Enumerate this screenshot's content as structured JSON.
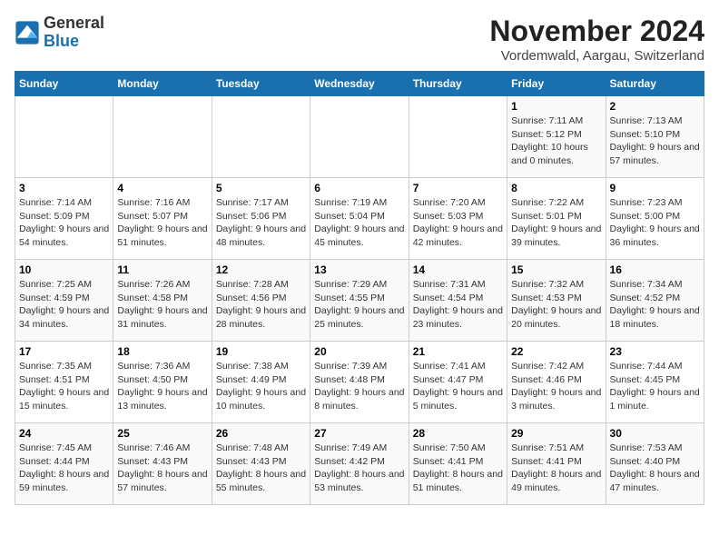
{
  "logo": {
    "general": "General",
    "blue": "Blue"
  },
  "header": {
    "title": "November 2024",
    "subtitle": "Vordemwald, Aargau, Switzerland"
  },
  "weekdays": [
    "Sunday",
    "Monday",
    "Tuesday",
    "Wednesday",
    "Thursday",
    "Friday",
    "Saturday"
  ],
  "weeks": [
    [
      {
        "day": "",
        "info": ""
      },
      {
        "day": "",
        "info": ""
      },
      {
        "day": "",
        "info": ""
      },
      {
        "day": "",
        "info": ""
      },
      {
        "day": "",
        "info": ""
      },
      {
        "day": "1",
        "info": "Sunrise: 7:11 AM\nSunset: 5:12 PM\nDaylight: 10 hours and 0 minutes."
      },
      {
        "day": "2",
        "info": "Sunrise: 7:13 AM\nSunset: 5:10 PM\nDaylight: 9 hours and 57 minutes."
      }
    ],
    [
      {
        "day": "3",
        "info": "Sunrise: 7:14 AM\nSunset: 5:09 PM\nDaylight: 9 hours and 54 minutes."
      },
      {
        "day": "4",
        "info": "Sunrise: 7:16 AM\nSunset: 5:07 PM\nDaylight: 9 hours and 51 minutes."
      },
      {
        "day": "5",
        "info": "Sunrise: 7:17 AM\nSunset: 5:06 PM\nDaylight: 9 hours and 48 minutes."
      },
      {
        "day": "6",
        "info": "Sunrise: 7:19 AM\nSunset: 5:04 PM\nDaylight: 9 hours and 45 minutes."
      },
      {
        "day": "7",
        "info": "Sunrise: 7:20 AM\nSunset: 5:03 PM\nDaylight: 9 hours and 42 minutes."
      },
      {
        "day": "8",
        "info": "Sunrise: 7:22 AM\nSunset: 5:01 PM\nDaylight: 9 hours and 39 minutes."
      },
      {
        "day": "9",
        "info": "Sunrise: 7:23 AM\nSunset: 5:00 PM\nDaylight: 9 hours and 36 minutes."
      }
    ],
    [
      {
        "day": "10",
        "info": "Sunrise: 7:25 AM\nSunset: 4:59 PM\nDaylight: 9 hours and 34 minutes."
      },
      {
        "day": "11",
        "info": "Sunrise: 7:26 AM\nSunset: 4:58 PM\nDaylight: 9 hours and 31 minutes."
      },
      {
        "day": "12",
        "info": "Sunrise: 7:28 AM\nSunset: 4:56 PM\nDaylight: 9 hours and 28 minutes."
      },
      {
        "day": "13",
        "info": "Sunrise: 7:29 AM\nSunset: 4:55 PM\nDaylight: 9 hours and 25 minutes."
      },
      {
        "day": "14",
        "info": "Sunrise: 7:31 AM\nSunset: 4:54 PM\nDaylight: 9 hours and 23 minutes."
      },
      {
        "day": "15",
        "info": "Sunrise: 7:32 AM\nSunset: 4:53 PM\nDaylight: 9 hours and 20 minutes."
      },
      {
        "day": "16",
        "info": "Sunrise: 7:34 AM\nSunset: 4:52 PM\nDaylight: 9 hours and 18 minutes."
      }
    ],
    [
      {
        "day": "17",
        "info": "Sunrise: 7:35 AM\nSunset: 4:51 PM\nDaylight: 9 hours and 15 minutes."
      },
      {
        "day": "18",
        "info": "Sunrise: 7:36 AM\nSunset: 4:50 PM\nDaylight: 9 hours and 13 minutes."
      },
      {
        "day": "19",
        "info": "Sunrise: 7:38 AM\nSunset: 4:49 PM\nDaylight: 9 hours and 10 minutes."
      },
      {
        "day": "20",
        "info": "Sunrise: 7:39 AM\nSunset: 4:48 PM\nDaylight: 9 hours and 8 minutes."
      },
      {
        "day": "21",
        "info": "Sunrise: 7:41 AM\nSunset: 4:47 PM\nDaylight: 9 hours and 5 minutes."
      },
      {
        "day": "22",
        "info": "Sunrise: 7:42 AM\nSunset: 4:46 PM\nDaylight: 9 hours and 3 minutes."
      },
      {
        "day": "23",
        "info": "Sunrise: 7:44 AM\nSunset: 4:45 PM\nDaylight: 9 hours and 1 minute."
      }
    ],
    [
      {
        "day": "24",
        "info": "Sunrise: 7:45 AM\nSunset: 4:44 PM\nDaylight: 8 hours and 59 minutes."
      },
      {
        "day": "25",
        "info": "Sunrise: 7:46 AM\nSunset: 4:43 PM\nDaylight: 8 hours and 57 minutes."
      },
      {
        "day": "26",
        "info": "Sunrise: 7:48 AM\nSunset: 4:43 PM\nDaylight: 8 hours and 55 minutes."
      },
      {
        "day": "27",
        "info": "Sunrise: 7:49 AM\nSunset: 4:42 PM\nDaylight: 8 hours and 53 minutes."
      },
      {
        "day": "28",
        "info": "Sunrise: 7:50 AM\nSunset: 4:41 PM\nDaylight: 8 hours and 51 minutes."
      },
      {
        "day": "29",
        "info": "Sunrise: 7:51 AM\nSunset: 4:41 PM\nDaylight: 8 hours and 49 minutes."
      },
      {
        "day": "30",
        "info": "Sunrise: 7:53 AM\nSunset: 4:40 PM\nDaylight: 8 hours and 47 minutes."
      }
    ]
  ]
}
